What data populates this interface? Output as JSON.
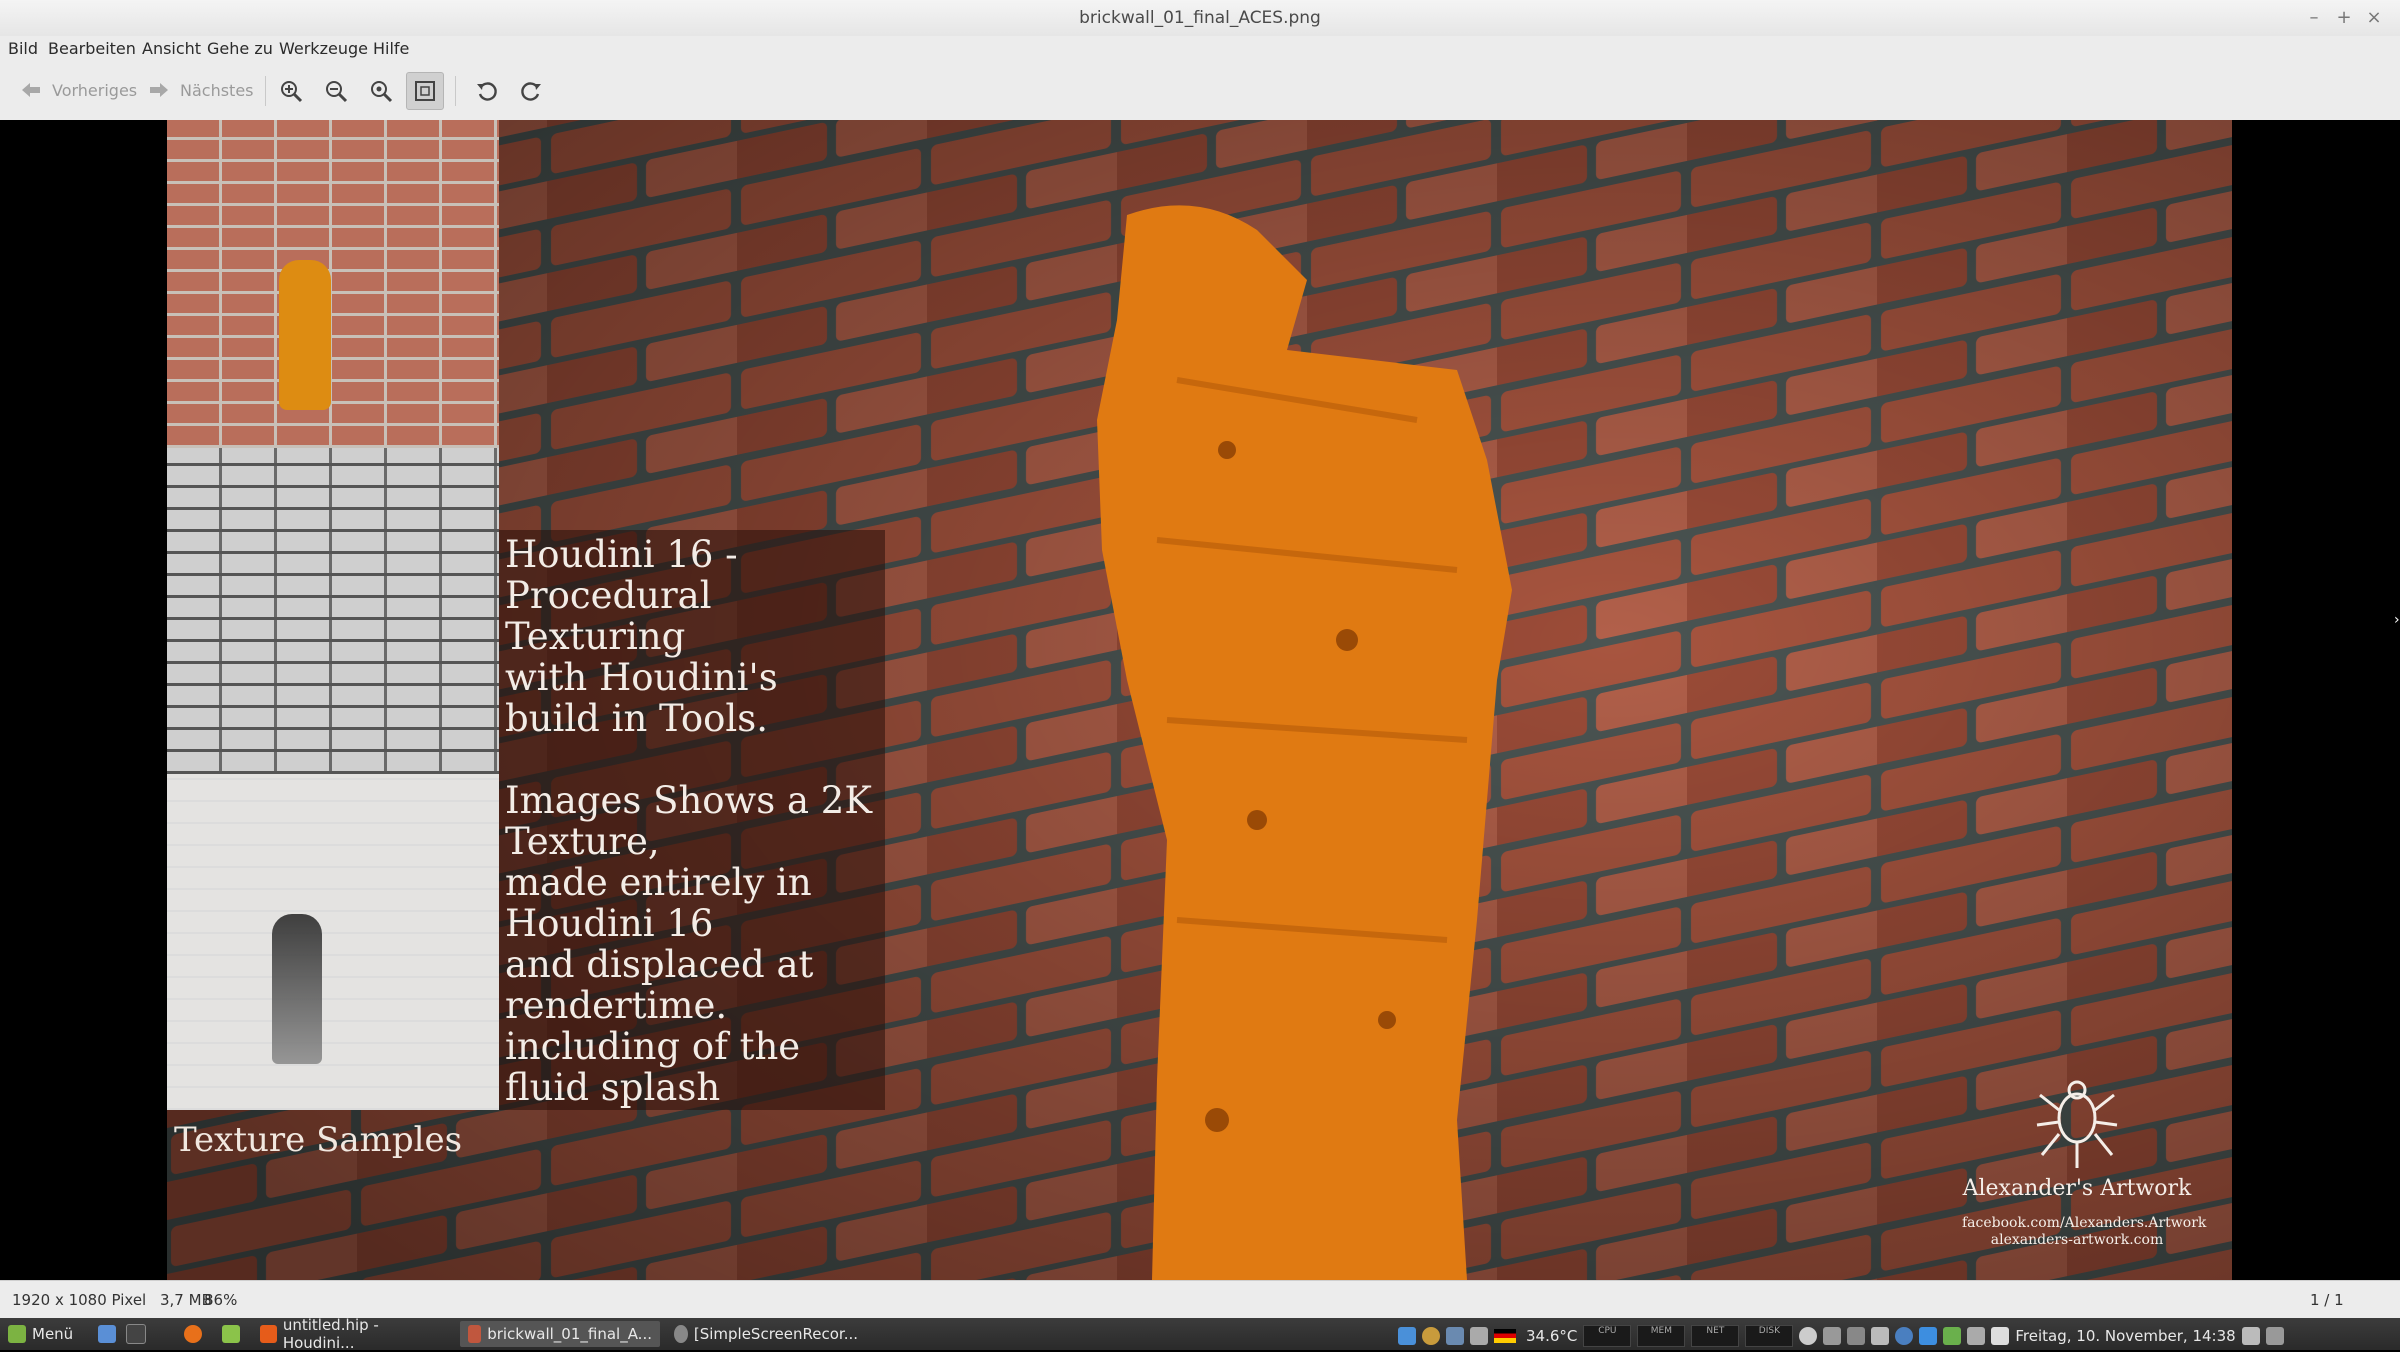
{
  "window": {
    "title": "brickwall_01_final_ACES.png"
  },
  "menu": [
    "Bild",
    "Bearbeiten",
    "Ansicht",
    "Gehe zu",
    "Werkzeuge",
    "Hilfe"
  ],
  "toolbar": {
    "prev_label": "Vorheriges",
    "next_label": "Nächstes"
  },
  "image": {
    "overlay_heading": "Houdini 16 -\nProcedural\nTexturing\nwith Houdini's\nbuild in Tools.",
    "overlay_body": "Images Shows a 2K\nTexture,\nmade entirely in\nHoudini 16\nand displaced at\nrendertime.\nincluding of the\nfluid splash",
    "caption": "Texture Samples",
    "brand": "Alexander's Artwork",
    "link1": "facebook.com/Alexanders.Artwork",
    "link2": "alexanders-artwork.com"
  },
  "status": {
    "dimensions": "1920 x 1080 Pixel",
    "size": "3,7 MB",
    "zoom": "86%",
    "page": "1 / 1"
  },
  "taskbar": {
    "menu_label": "Menü",
    "tasks": [
      "untitled.hip - Houdini...",
      "brickwall_01_final_A...",
      "[SimpleScreenRecor..."
    ],
    "temperature": "34.6°C",
    "cpu_label": "CPU",
    "mem_label": "MEM",
    "net_label": "NET",
    "disk_label": "DISK",
    "clock": "Freitag, 10. November, 14:38"
  },
  "colors": {
    "accent_orange": "#e07a12",
    "brick": "#a8553f",
    "taskbar_bg": "#2f2f2f"
  }
}
